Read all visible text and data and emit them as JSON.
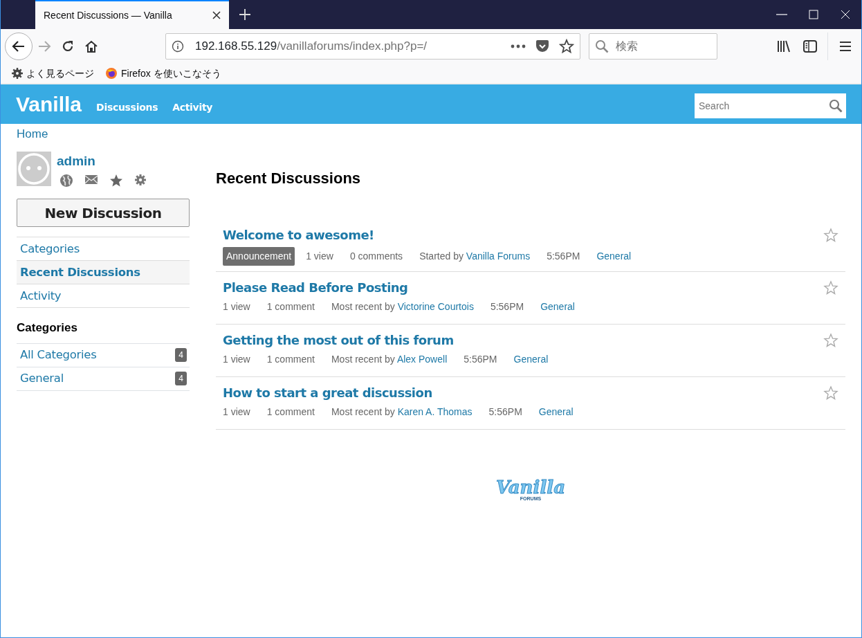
{
  "browser": {
    "tab_title": "Recent Discussions — Vanilla",
    "url_host": "192.168.55.129",
    "url_path": "/vanillaforums/index.php?p=/",
    "search_placeholder": "検索",
    "bookmarks": [
      {
        "kind": "gear",
        "label": "よく見るページ"
      },
      {
        "kind": "firefox",
        "label": "Firefox を使いこなそう"
      }
    ]
  },
  "site": {
    "logo": "Vanilla",
    "nav": [
      "Discussions",
      "Activity"
    ],
    "search_placeholder": "Search"
  },
  "breadcrumb": "Home",
  "user": {
    "name": "admin"
  },
  "new_discussion_button": "New Discussion",
  "sidebar_nav": [
    {
      "label": "Categories",
      "selected": false
    },
    {
      "label": "Recent Discussions",
      "selected": true
    },
    {
      "label": "Activity",
      "selected": false
    }
  ],
  "categories_heading": "Categories",
  "categories": [
    {
      "label": "All Categories",
      "count": "4"
    },
    {
      "label": "General",
      "count": "4"
    }
  ],
  "page_title": "Recent Discussions",
  "discussions": [
    {
      "title": "Welcome to awesome!",
      "bookmarked": false,
      "tag": "Announcement",
      "views": "1 view",
      "comments": "0 comments",
      "by_label": "Started by",
      "user": "Vanilla Forums",
      "time": "5:56PM",
      "category": "General"
    },
    {
      "title": "Please Read Before Posting",
      "bookmarked": false,
      "views": "1 view",
      "comments": "1 comment",
      "by_label": "Most recent by",
      "user": "Victorine Courtois",
      "time": "5:56PM",
      "category": "General"
    },
    {
      "title": "Getting the most out of this forum",
      "bookmarked": false,
      "views": "1 view",
      "comments": "1 comment",
      "by_label": "Most recent by",
      "user": "Alex Powell",
      "time": "5:56PM",
      "category": "General"
    },
    {
      "title": "How to start a great discussion",
      "bookmarked": false,
      "views": "1 view",
      "comments": "1 comment",
      "by_label": "Most recent by",
      "user": "Karen A. Thomas",
      "time": "5:56PM",
      "category": "General"
    }
  ],
  "footer_logo": {
    "text": "Vanilla",
    "subtext": "FORUMS"
  }
}
